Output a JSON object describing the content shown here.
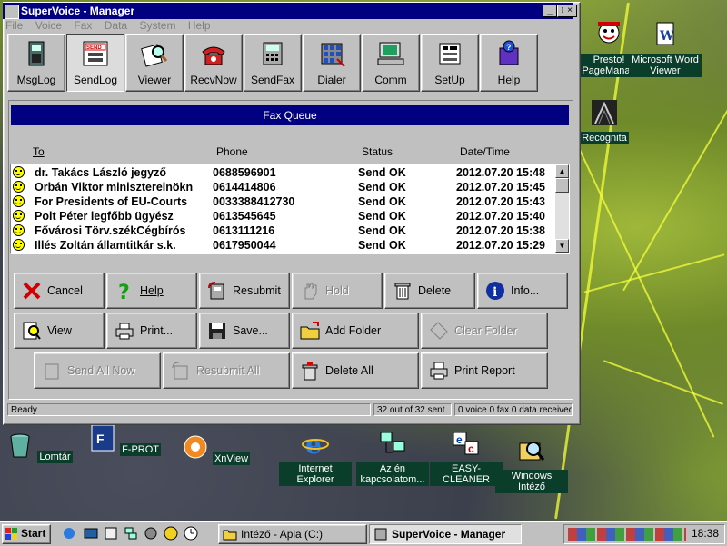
{
  "window": {
    "title": "SuperVoice - Manager",
    "min": "_",
    "max": "□",
    "close": "×"
  },
  "menu": [
    "File",
    "Voice",
    "Fax",
    "Data",
    "System",
    "Help"
  ],
  "toolbar": [
    "MsgLog",
    "SendLog",
    "Viewer",
    "RecvNow",
    "SendFax",
    "Dialer",
    "Comm",
    "SetUp",
    "Help"
  ],
  "toolbar_active": "SendLog",
  "queue": {
    "title": "Fax Queue",
    "columns": {
      "to": "To",
      "phone": "Phone",
      "status": "Status",
      "datetime": "Date/Time"
    },
    "rows": [
      {
        "to": "dr. Takács László jegyző",
        "phone": "0688596901",
        "status": "Send OK",
        "datetime": "2012.07.20 15:48"
      },
      {
        "to": "Orbán Viktor miniszterelnökn",
        "phone": "0614414806",
        "status": "Send OK",
        "datetime": "2012.07.20 15:45"
      },
      {
        "to": "For Presidents of EU-Courts",
        "phone": "0033388412730",
        "status": "Send OK",
        "datetime": "2012.07.20 15:43"
      },
      {
        "to": "Polt Péter legfőbb ügyész",
        "phone": "0613545645",
        "status": "Send OK",
        "datetime": "2012.07.20 15:40"
      },
      {
        "to": "Fővárosi Törv.székCégbírós",
        "phone": "0613111216",
        "status": "Send OK",
        "datetime": "2012.07.20 15:38"
      },
      {
        "to": "Illés Zoltán államtitkár s.k.",
        "phone": "0617950044",
        "status": "Send OK",
        "datetime": "2012.07.20 15:29"
      }
    ]
  },
  "buttons": {
    "cancel": "Cancel",
    "help": "Help",
    "resubmit": "Resubmit",
    "hold": "Hold",
    "delete": "Delete",
    "info": "Info...",
    "view": "View",
    "print": "Print...",
    "save": "Save...",
    "add_folder": "Add Folder",
    "clear_folder": "Clear Folder",
    "send_all_now": "Send All Now",
    "resubmit_all": "Resubmit All",
    "delete_all": "Delete All",
    "print_report": "Print Report"
  },
  "status": {
    "ready": "Ready",
    "sent": "32 out of 32 sent",
    "counts": "0 voice 0 fax 0 data  received"
  },
  "desktop_icons": {
    "presto": "Presto! PageManag",
    "msword": "Microsoft Word Viewer",
    "recognita": "Recognita",
    "lomtar": "Lomtár",
    "fprot": "F-PROT",
    "xnview": "XnView",
    "ie": "Internet Explorer",
    "azen": "Az én kapcsolatom...",
    "easy": "EASY-CLEANER",
    "wintezo": "Windows Intéző"
  },
  "taskbar": {
    "start": "Start",
    "item1": "Intéző - Apla (C:)",
    "item2": "SuperVoice - Manager",
    "clock": "18:38"
  }
}
